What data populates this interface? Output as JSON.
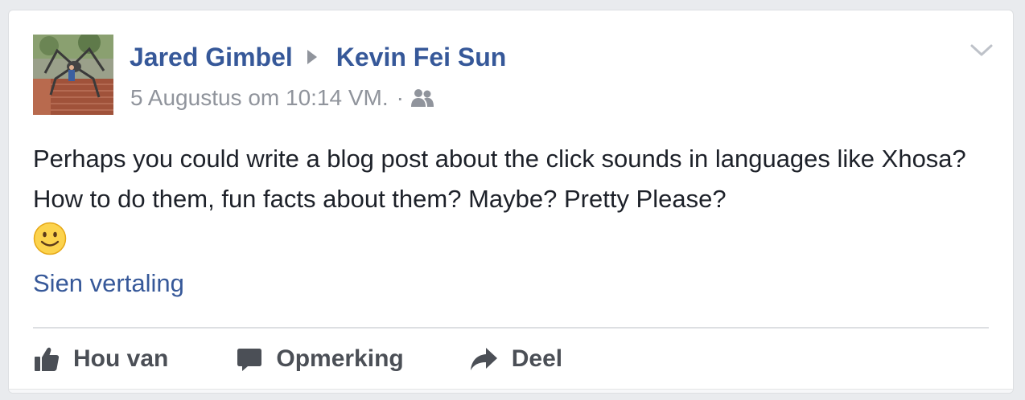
{
  "post": {
    "author": "Jared Gimbel",
    "recipient": "Kevin Fei Sun",
    "timestamp": "5 Augustus om 10:14 VM.",
    "separator": "·",
    "audience_icon": "friends-icon",
    "text": "Perhaps you could write a blog post about the click sounds in languages like Xhosa? How to do them, fun facts about them? Maybe? Pretty Please?",
    "emoji": "slightly-smiling-face-icon",
    "see_translation": "Sien vertaling",
    "menu_icon": "chevron-down-icon"
  },
  "actions": {
    "like": "Hou van",
    "comment": "Opmerking",
    "share": "Deel"
  },
  "colors": {
    "link": "#365899",
    "meta": "#90949c",
    "text": "#1d2129",
    "action": "#4b4f56",
    "divider": "#dddfe2",
    "background": "#e9ebee"
  }
}
